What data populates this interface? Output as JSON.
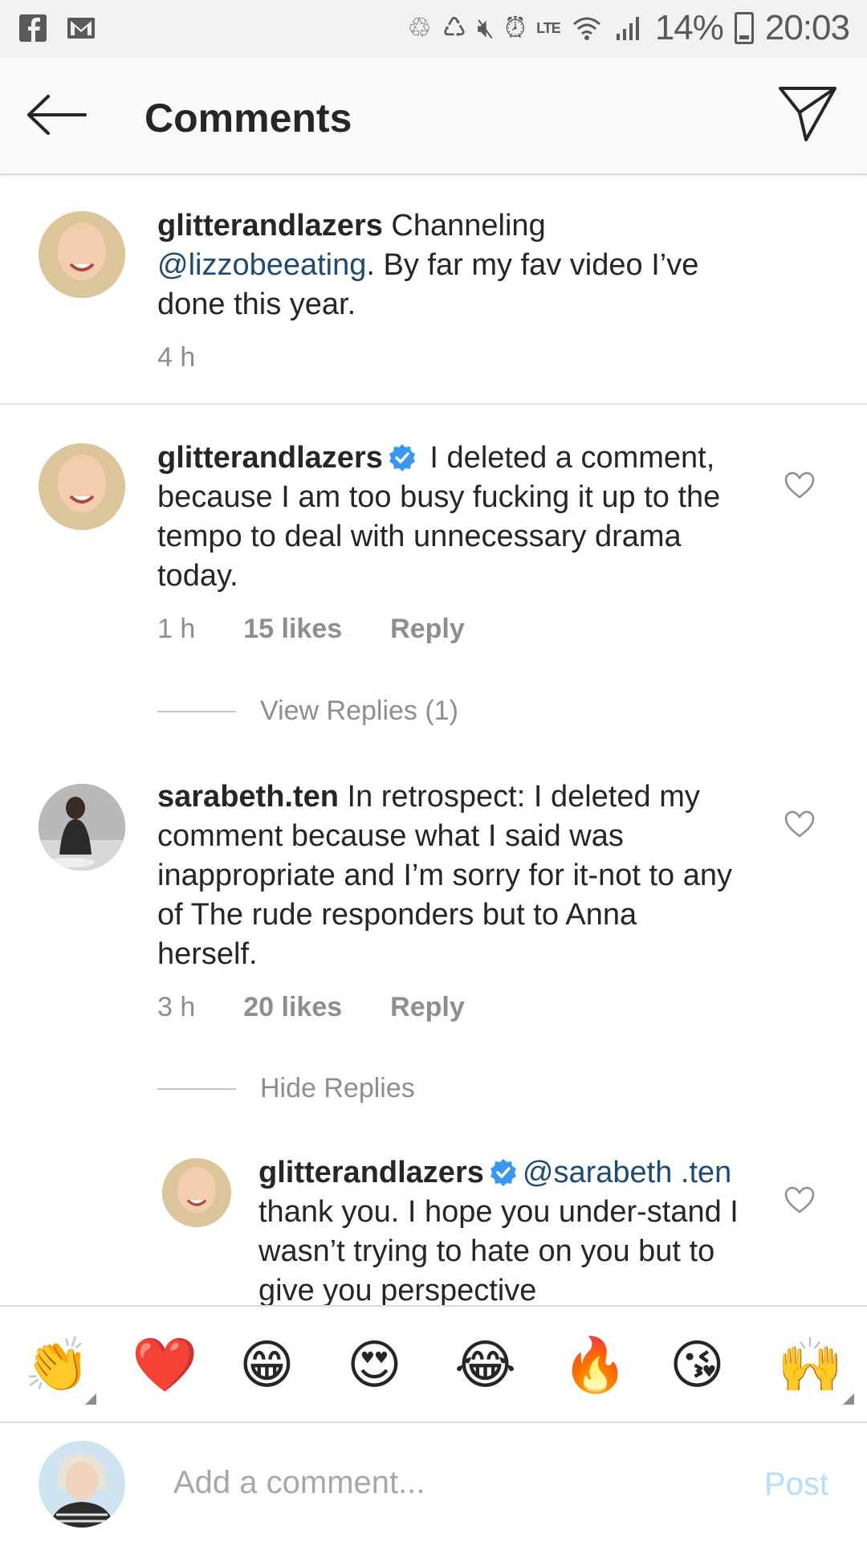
{
  "status_bar": {
    "battery": "14%",
    "time": "20:03",
    "network": "LTE",
    "left_icons": [
      "facebook-icon",
      "gmail-icon"
    ],
    "right_icons": [
      "recycle-icon",
      "recycle-icon",
      "mute-icon",
      "alarm-icon",
      "volte-icon",
      "wifi-icon",
      "signal-icon",
      "battery-icon"
    ]
  },
  "header": {
    "title": "Comments",
    "back_icon": "arrow-left-icon",
    "send_icon": "paper-plane-icon"
  },
  "caption": {
    "username": "glitterandlazers",
    "text_1": " Channeling ",
    "mention": "@lizzobeeating",
    "text_2": ". By far my fav video I’ve done this year.",
    "time": "4 h"
  },
  "comments": [
    {
      "username": "glitterandlazers",
      "verified": true,
      "text": " I deleted a comment, because I am too busy fucking it up to the tempo to deal with unnecessary drama today.",
      "time": "1 h",
      "likes": "15 likes",
      "reply_label": "Reply",
      "replies_toggle": "View Replies (1)"
    },
    {
      "username": "sarabeth.ten",
      "verified": false,
      "text": " In retrospect: I deleted my comment because what I said was inappropriate and I’m sorry for it-not to any of The rude responders but to Anna herself.",
      "time": "3 h",
      "likes": "20 likes",
      "reply_label": "Reply",
      "replies_toggle": "Hide Replies"
    }
  ],
  "reply": {
    "username": "glitterandlazers",
    "verified": true,
    "mention": "@sarabeth .ten",
    "text": " thank you. I hope you under-stand I wasn’t trying to hate on you but to give you perspective"
  },
  "emoji_bar": [
    "👏",
    "❤️",
    "😁",
    "😍",
    "😂",
    "🔥",
    "😘",
    "🙌"
  ],
  "input": {
    "placeholder": "Add a comment...",
    "post_label": "Post"
  },
  "colors": {
    "mention": "#1f4a73",
    "verified": "#3897f0",
    "secondary_text": "#8e8e8e",
    "post_disabled": "#b2dffc"
  }
}
